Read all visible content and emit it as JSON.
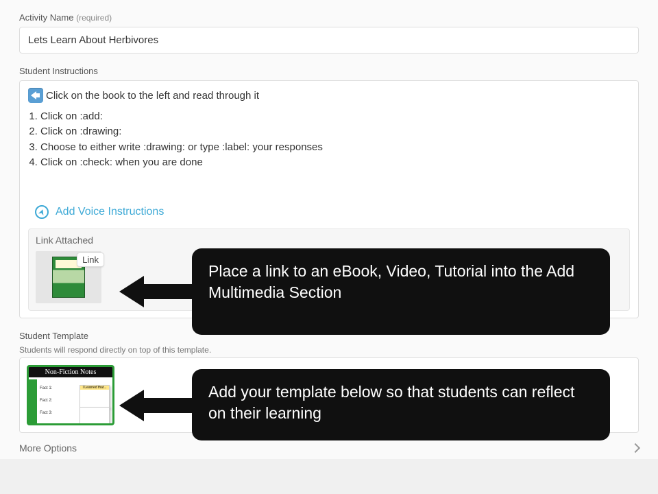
{
  "activity_name": {
    "label": "Activity Name",
    "required": "(required)",
    "value": "Lets Learn About Herbivores"
  },
  "instructions": {
    "label": "Student Instructions",
    "lead_line": "Click on the book to the left and read through it",
    "steps": [
      "Click on :add:",
      "Click on :drawing:",
      "Choose to either write :drawing: or type :label: your responses",
      "Click on :check: when you are done"
    ],
    "voice_label": "Add Voice Instructions",
    "attachment": {
      "header": "Link Attached",
      "badge": "Link"
    }
  },
  "template": {
    "label": "Student Template",
    "sub": "Students will respond directly on top of this template.",
    "thumb_title": "Non-Fiction Notes",
    "facts": [
      "Fact 1:",
      "Fact 2:",
      "Fact 3:"
    ],
    "sticky_header": "I Learned that..."
  },
  "more_options": "More Options",
  "callouts": {
    "c1": "Place a link to an eBook, Video, Tutorial into the Add Multimedia Section",
    "c2": "Add your template below so that students can reflect on their learning"
  }
}
